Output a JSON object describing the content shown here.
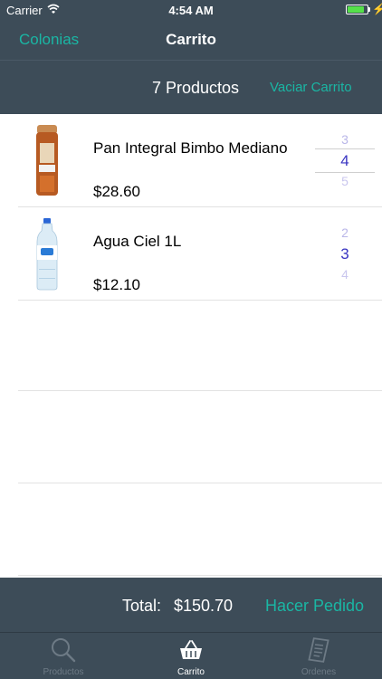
{
  "status": {
    "carrier": "Carrier",
    "time": "4:54 AM",
    "battery_level": 0.85
  },
  "nav": {
    "back_label": "Colonias",
    "title": "Carrito"
  },
  "cart_header": {
    "count_label": "7 Productos",
    "clear_label": "Vaciar Carrito"
  },
  "items": [
    {
      "name": "Pan Integral Bimbo Mediano",
      "price": "$28.60",
      "qty_prev": "3",
      "qty": "4",
      "qty_next": "5",
      "image_icon": "bread-bag-icon"
    },
    {
      "name": "Agua Ciel 1L",
      "price": "$12.10",
      "qty_prev": "2",
      "qty": "3",
      "qty_next": "4",
      "image_icon": "water-bottle-icon"
    }
  ],
  "footer": {
    "total_label": "Total:",
    "total_value": "$150.70",
    "order_label": "Hacer Pedido"
  },
  "tabs": [
    {
      "label": "Productos",
      "icon": "search-icon",
      "active": false
    },
    {
      "label": "Carrito",
      "icon": "basket-icon",
      "active": true
    },
    {
      "label": "Ordenes",
      "icon": "receipt-icon",
      "active": false
    }
  ],
  "colors": {
    "bar": "#3d4c58",
    "accent": "#1ab6a4",
    "picker": "#3a35c2"
  }
}
